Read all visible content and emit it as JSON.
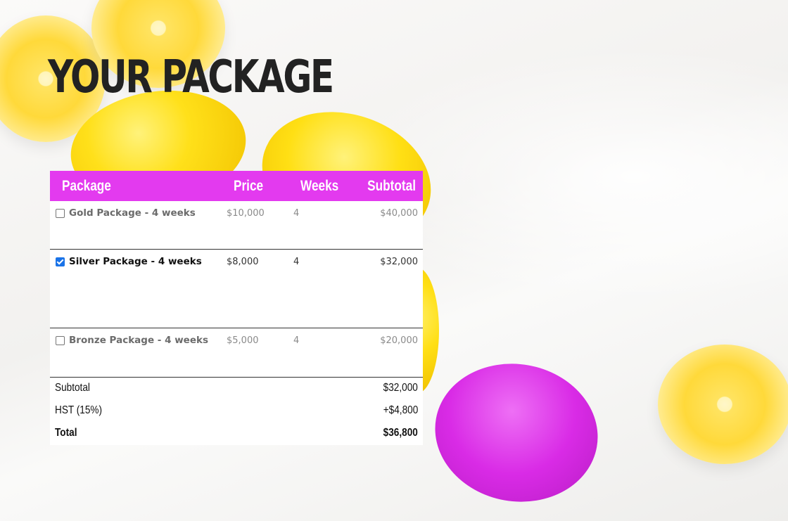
{
  "page": {
    "title": "YOUR PACKAGE"
  },
  "table": {
    "headers": {
      "package": "Package",
      "price": "Price",
      "weeks": "Weeks",
      "subtotal": "Subtotal"
    },
    "rows": [
      {
        "name": "Gold Package - 4 weeks",
        "price": "$10,000",
        "weeks": "4",
        "subtotal": "$40,000",
        "checked": false
      },
      {
        "name": "Silver Package - 4 weeks",
        "price": "$8,000",
        "weeks": "4",
        "subtotal": "$32,000",
        "checked": true
      },
      {
        "name": "Bronze Package - 4 weeks",
        "price": "$5,000",
        "weeks": "4",
        "subtotal": "$20,000",
        "checked": false
      }
    ]
  },
  "totals": {
    "subtotal_label": "Subtotal",
    "subtotal_value": "$32,000",
    "tax_label": "HST (15%)",
    "tax_value": "+$4,800",
    "total_label": "Total",
    "total_value": "$36,800"
  },
  "colors": {
    "header_bg": "#e33aef",
    "lemon_yellow": "#f7c400",
    "lemon_magenta": "#d92be6",
    "checkbox_checked": "#1a73e8"
  }
}
